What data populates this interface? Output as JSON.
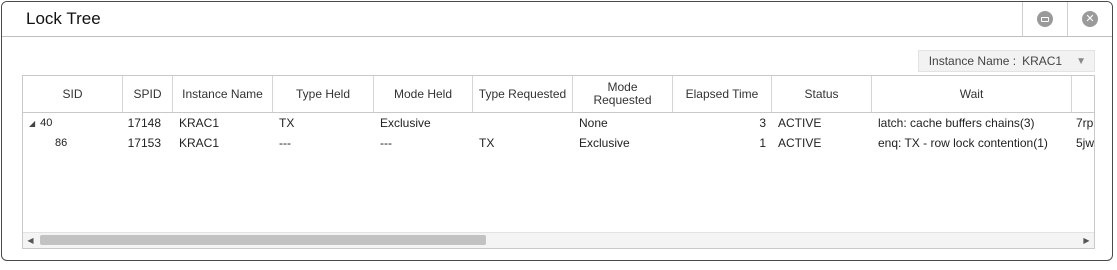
{
  "window": {
    "title": "Lock Tree",
    "minimize_icon": "minimize-icon",
    "close_icon": "close-icon"
  },
  "filter": {
    "label": "Instance Name :",
    "value": "KRAC1"
  },
  "grid": {
    "columns": [
      "SID",
      "SPID",
      "Instance Name",
      "Type Held",
      "Mode Held",
      "Type Requested",
      "Mode Requested",
      "Elapsed Time",
      "Status",
      "Wait",
      ""
    ],
    "rows": [
      {
        "sid": "40",
        "spid": "17148",
        "instance": "KRAC1",
        "type_held": "TX",
        "mode_held": "Exclusive",
        "type_requested": "",
        "mode_requested": "None",
        "elapsed": "3",
        "status": "ACTIVE",
        "wait": "latch: cache buffers chains(3)",
        "extra": "7rp",
        "expanded": true
      },
      {
        "sid": "86",
        "spid": "17153",
        "instance": "KRAC1",
        "type_held": "---",
        "mode_held": "---",
        "type_requested": "TX",
        "mode_requested": "Exclusive",
        "elapsed": "1",
        "status": "ACTIVE",
        "wait": "enq: TX - row lock contention(1)",
        "extra": "5jw",
        "expanded": false
      }
    ],
    "scroll_fraction": 0.42
  }
}
